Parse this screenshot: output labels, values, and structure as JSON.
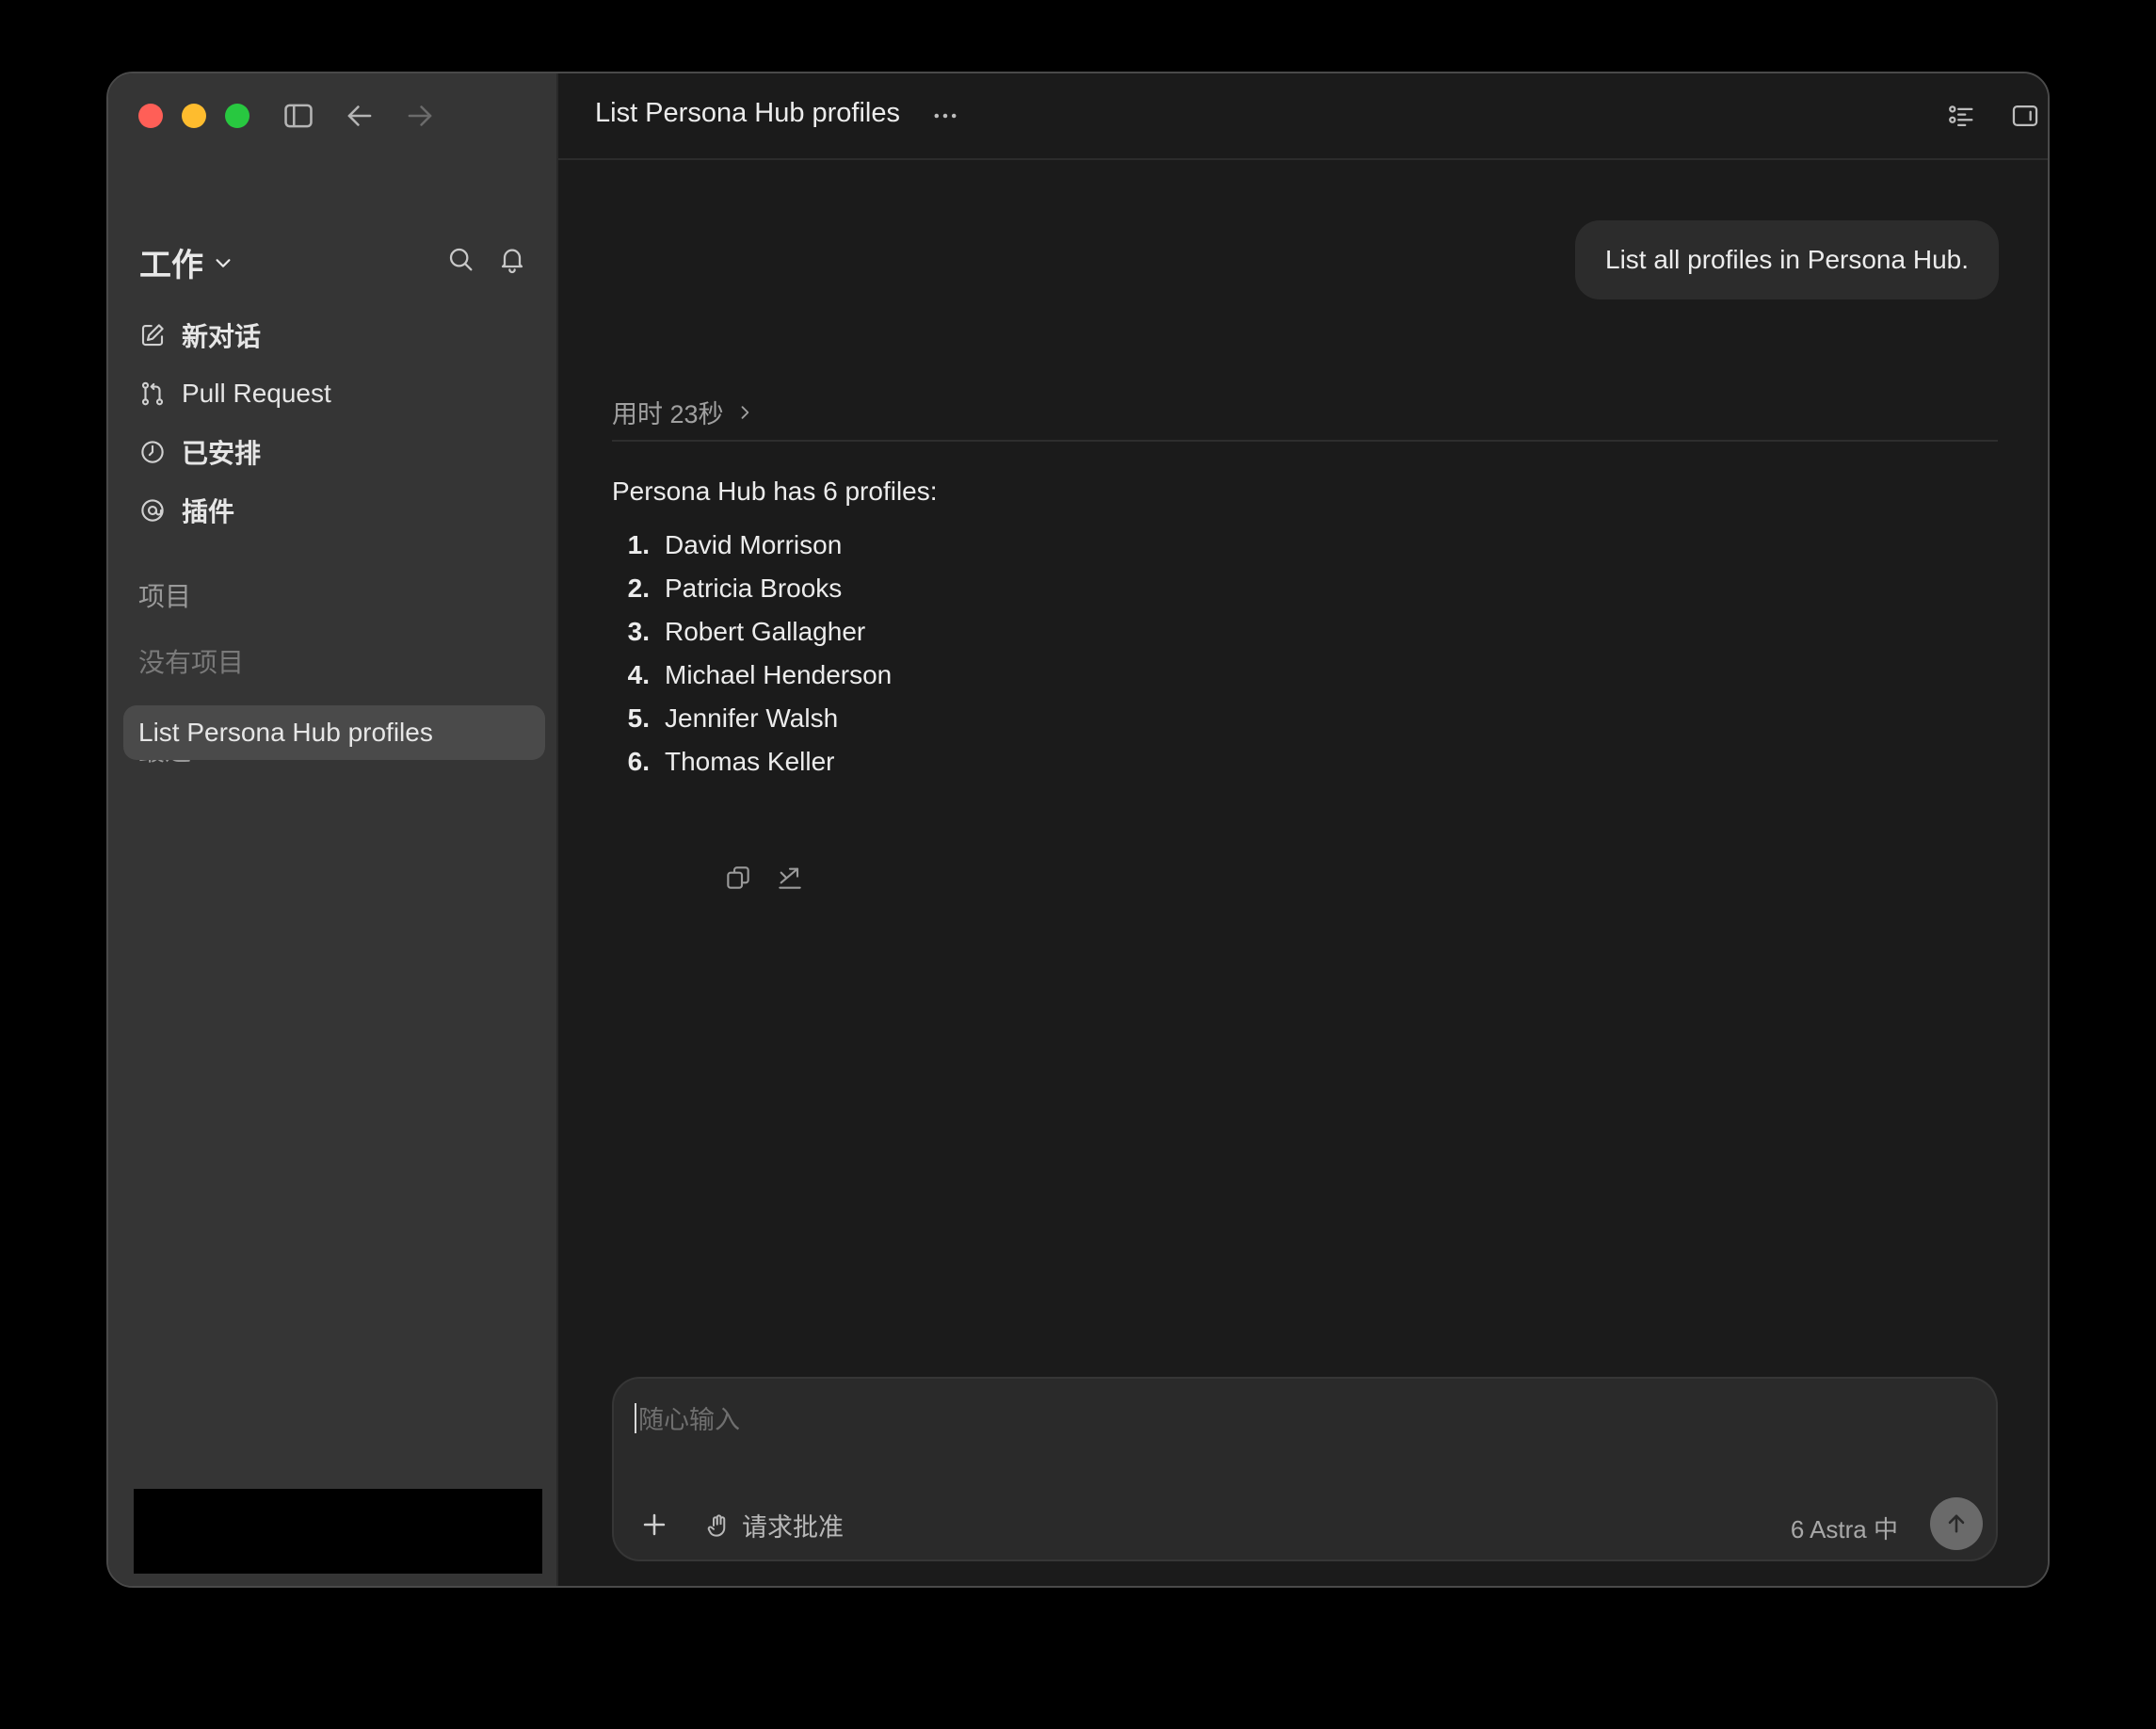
{
  "sidebar": {
    "workspace": "工作",
    "nav": [
      {
        "label": "新对话",
        "icon": "compose-icon"
      },
      {
        "label": "Pull Request",
        "icon": "git-pull-request-icon"
      },
      {
        "label": "已安排",
        "icon": "clock-icon"
      },
      {
        "label": "插件",
        "icon": "plugin-icon"
      }
    ],
    "projects_label": "项目",
    "no_projects": "没有项目",
    "recent_label": "最近",
    "recent_items": [
      {
        "label": "List Persona Hub profiles",
        "selected": true
      }
    ]
  },
  "header": {
    "title": "List Persona Hub profiles"
  },
  "conversation": {
    "user_message": "List all profiles in Persona Hub.",
    "timing": "用时 23秒",
    "answer_intro": "Persona Hub has 6 profiles:",
    "profiles": [
      {
        "num": "1.",
        "name": "David Morrison"
      },
      {
        "num": "2.",
        "name": "Patricia Brooks"
      },
      {
        "num": "3.",
        "name": "Robert Gallagher"
      },
      {
        "num": "4.",
        "name": "Michael Henderson"
      },
      {
        "num": "5.",
        "name": "Jennifer Walsh"
      },
      {
        "num": "6.",
        "name": "Thomas Keller"
      }
    ]
  },
  "composer": {
    "placeholder": "随心输入",
    "approval_label": "请求批准",
    "model_label": "6 Astra 中"
  },
  "colors": {
    "traffic_red": "#ff5f57",
    "traffic_yellow": "#febc2e",
    "traffic_green": "#28c840",
    "sidebar_bg": "#353535",
    "main_bg": "#1b1b1b"
  }
}
